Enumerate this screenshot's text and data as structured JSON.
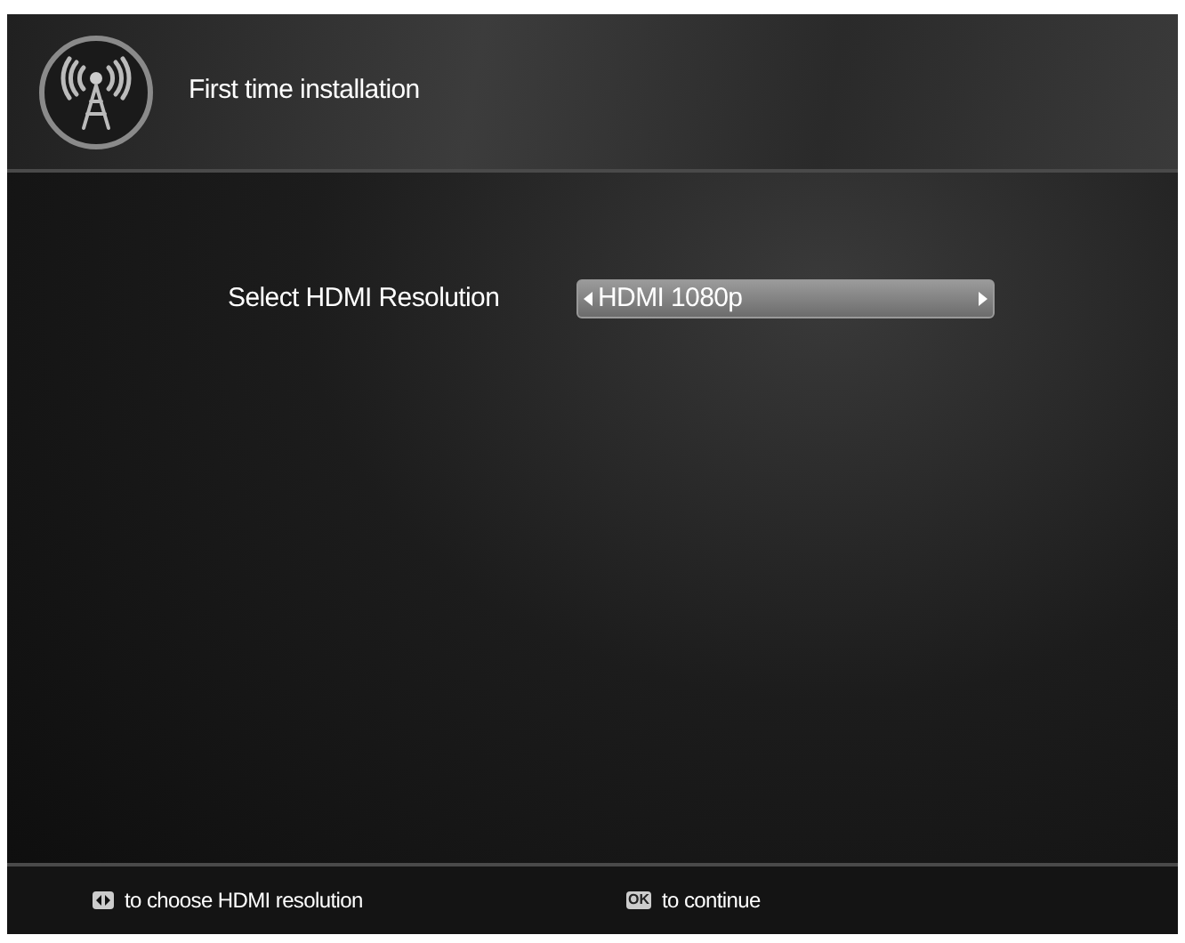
{
  "header": {
    "title": "First time installation"
  },
  "setting": {
    "label": "Select HDMI Resolution",
    "value": "HDMI 1080p"
  },
  "hints": [
    {
      "kind": "leftright",
      "text": "to choose HDMI resolution"
    },
    {
      "kind": "ok",
      "key_label": "OK",
      "text": "to continue"
    }
  ]
}
